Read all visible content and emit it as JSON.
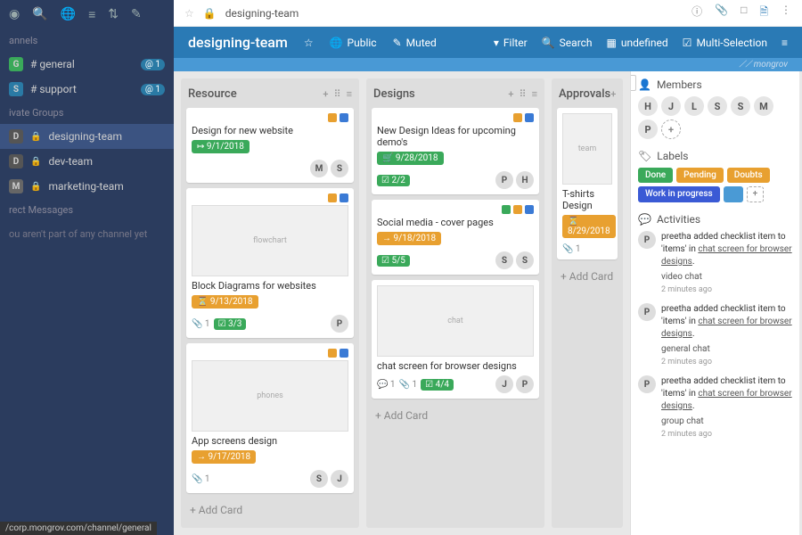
{
  "sidebar": {
    "sections": {
      "channels": "annels",
      "private": "ivate Groups",
      "direct": "rect Messages"
    },
    "channels": [
      {
        "b": "G",
        "name": "# general",
        "m": "@ 1"
      },
      {
        "b": "S",
        "name": "# support",
        "m": "@ 1"
      }
    ],
    "groups": [
      {
        "b": "D",
        "name": "designing-team",
        "active": true
      },
      {
        "b": "D",
        "name": "dev-team"
      },
      {
        "b": "M",
        "name": "marketing-team"
      }
    ],
    "empty": "ou aren't part of any channel yet",
    "url": "/corp.mongrov.com/channel/general"
  },
  "topbar": {
    "title": "designing-team",
    "lock": "🔒"
  },
  "header": {
    "title": "designing-team",
    "public": "Public",
    "muted": "Muted",
    "filter": "Filter",
    "search": "Search",
    "undef": "undefined",
    "multi": "Multi-Selection"
  },
  "brand": "mongrov",
  "lists": [
    {
      "title": "Resource",
      "cards": [
        {
          "title": "Design for new website",
          "labels": [
            "or",
            "bl"
          ],
          "date": "9/1/2018",
          "dateColor": "green",
          "arrow": "↦",
          "members": [
            "M",
            "S"
          ]
        },
        {
          "thumb": "flowchart",
          "title": "Block Diagrams for websites",
          "labels": [
            "or",
            "bl"
          ],
          "date": "9/13/2018",
          "dateColor": "orange",
          "arrow": "⏳",
          "attach": "1",
          "chk": "3/3",
          "members": [
            "P"
          ]
        },
        {
          "thumb": "phones",
          "title": "App screens design",
          "labels": [
            "or",
            "bl"
          ],
          "date": "9/17/2018",
          "dateColor": "orange",
          "arrow": "→",
          "attach": "1",
          "members": [
            "S",
            "J"
          ]
        }
      ],
      "add": "Add Card"
    },
    {
      "title": "Designs",
      "cards": [
        {
          "title": "New Design Ideas for upcoming demo's",
          "labels": [
            "or",
            "bl"
          ],
          "date": "9/28/2018",
          "dateColor": "green",
          "arrow": "🛒",
          "chk": "2/2",
          "members": [
            "P",
            "H"
          ]
        },
        {
          "title": "Social media - cover pages",
          "labels": [
            "gr",
            "or",
            "bl"
          ],
          "date": "9/18/2018",
          "dateColor": "orange",
          "arrow": "→",
          "chk": "5/5",
          "members": [
            "S",
            "S"
          ]
        },
        {
          "thumb": "chat",
          "title": "chat screen for browser designs",
          "comments": "1",
          "attach": "1",
          "chk": "4/4",
          "members": [
            "J",
            "P"
          ]
        }
      ],
      "add": "Add Card"
    },
    {
      "title": "Approvals",
      "cards": [
        {
          "thumb": "team",
          "title": "T-shirts Design",
          "date": "8/29/2018",
          "dateColor": "orange",
          "arrow": "⏳",
          "attach": "1"
        }
      ],
      "add": "Add Card"
    }
  ],
  "rpanel": {
    "members": {
      "title": "Members",
      "list": [
        "H",
        "J",
        "L",
        "S",
        "S",
        "M",
        "P"
      ]
    },
    "labels": {
      "title": "Labels",
      "done": "Done",
      "pending": "Pending",
      "doubts": "Doubts",
      "wip": "Work in progress"
    },
    "activities": {
      "title": "Activities",
      "items": [
        {
          "user": "P",
          "name": "preetha",
          "text": "added checklist item to 'items' in",
          "link": "chat screen for browser designs",
          "sub": "video chat",
          "time": "2 minutes ago"
        },
        {
          "user": "P",
          "name": "preetha",
          "text": "added checklist item to 'items' in",
          "link": "chat screen for browser designs",
          "sub": "general chat",
          "time": "2 minutes ago"
        },
        {
          "user": "P",
          "name": "preetha",
          "text": "added checklist item to 'items' in",
          "link": "chat screen for browser designs",
          "sub": "group chat",
          "time": "2 minutes ago"
        }
      ]
    }
  }
}
